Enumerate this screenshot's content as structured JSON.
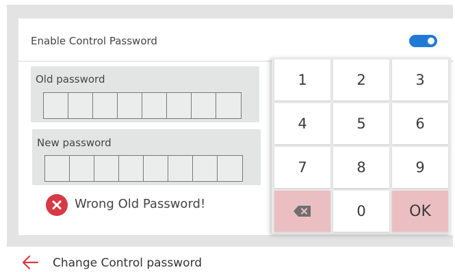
{
  "settings": {
    "enable_label": "Enable Control Password",
    "enable_toggle_on": true
  },
  "old_password": {
    "label": "Old password",
    "digits": 8
  },
  "new_password": {
    "label": "New password",
    "digits": 8
  },
  "error": {
    "message": "Wrong Old Password!"
  },
  "keypad": {
    "keys": [
      "1",
      "2",
      "3",
      "4",
      "5",
      "6",
      "7",
      "8",
      "9",
      "backspace",
      "0",
      "OK"
    ],
    "zero": "0",
    "ok": "OK"
  },
  "footer": {
    "title": "Change Control password"
  },
  "colors": {
    "accent": "#1f7ad6",
    "error": "#d63a45",
    "key_special": "#ebbfc2",
    "back_arrow": "#d63a45"
  },
  "icons": {
    "toggle": "toggle-switch",
    "error": "x-circle-icon",
    "backspace": "backspace-icon",
    "back": "arrow-left-icon"
  }
}
